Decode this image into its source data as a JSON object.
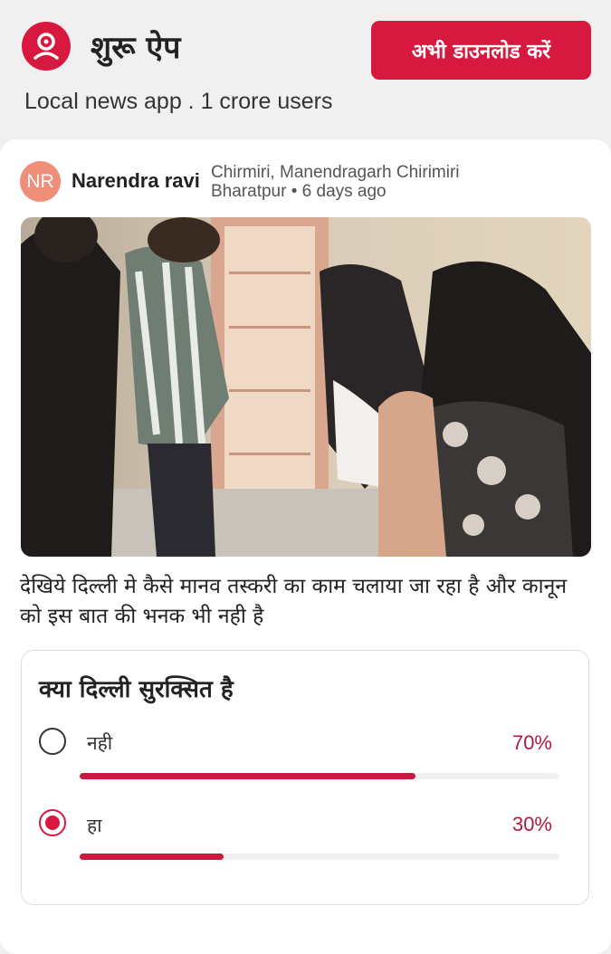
{
  "header": {
    "app_name": "शुरू ऐप",
    "download_label": "अभी डाउनलोड करें",
    "tagline": "Local news app . 1 crore users",
    "accent_color": "#d7193f",
    "logo_icon": "location-pin-person-icon"
  },
  "post": {
    "avatar_initials": "NR",
    "author": "Narendra ravi",
    "location_line1": "Chirmiri, Manendragarh Chirimiri",
    "location_line2": "Bharatpur • 6 days ago",
    "text": "देखिये दिल्ली मे कैसे मानव तस्करी का काम चलाया जा रहा है और कानून को इस बात की भनक भी नही है"
  },
  "poll": {
    "question": "क्या दिल्ली सुरक्सित है",
    "options": [
      {
        "label": "नही",
        "percent_label": "70%",
        "fraction": 0.7,
        "selected": false
      },
      {
        "label": "हा",
        "percent_label": "30%",
        "fraction": 0.3,
        "selected": true
      }
    ]
  }
}
